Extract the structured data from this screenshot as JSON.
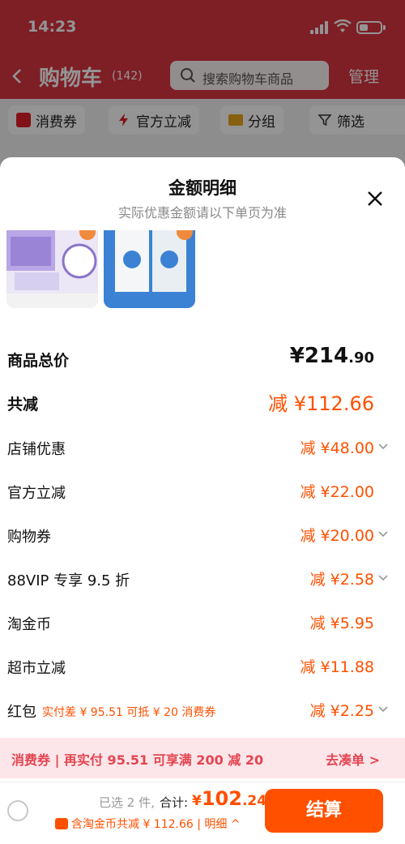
{
  "status": {
    "time": "14:23"
  },
  "header": {
    "title": "购物车",
    "count": "(142)",
    "search_placeholder": "搜索购物车商品",
    "manage": "管理"
  },
  "filters": [
    {
      "label": "消费券",
      "icon": "coupon-icon"
    },
    {
      "label": "官方立减",
      "icon": "lightning-icon"
    },
    {
      "label": "分组",
      "icon": "folder-icon"
    },
    {
      "label": "筛选",
      "icon": "filter-icon"
    }
  ],
  "sheet": {
    "title": "金额明细",
    "subtitle": "实际优惠金额请以下单页为准",
    "lines": [
      {
        "label": "商品总价",
        "value_main": "¥214",
        "value_dec": ".90"
      },
      {
        "label": "共减",
        "value": "减 ¥112.66"
      },
      {
        "label": "店铺优惠",
        "value": "减 ¥48.00"
      },
      {
        "label": "官方立减",
        "value": "减 ¥22.00"
      },
      {
        "label": "购物券",
        "value": "减 ¥20.00"
      },
      {
        "label": "88VIP 专享 9.5 折",
        "value": "减 ¥2.58"
      },
      {
        "label": "淘金币",
        "value": "减 ¥5.95"
      },
      {
        "label": "超市立减",
        "value": "减 ¥11.88"
      },
      {
        "label": "红包",
        "note": "实付差 ¥ 95.51 可抵 ¥ 20 消费券",
        "value": "减 ¥2.25"
      }
    ],
    "coupon_bar": {
      "text": "消费券 | 再实付 95.51 可享满 200 减 20",
      "link": "去凑单 >"
    }
  },
  "footer": {
    "selected": "已选 2 件,",
    "total_label": "合计:",
    "total_symbol": "¥",
    "total_main": "102",
    "total_dec": ".24",
    "coin_note": "含淘金币共减 ¥ 112.66 | 明细 ^",
    "checkout": "结算"
  },
  "colors": {
    "accent": "#ff5000",
    "header": "#d93540",
    "coupon_bar": "#fde6ea"
  }
}
